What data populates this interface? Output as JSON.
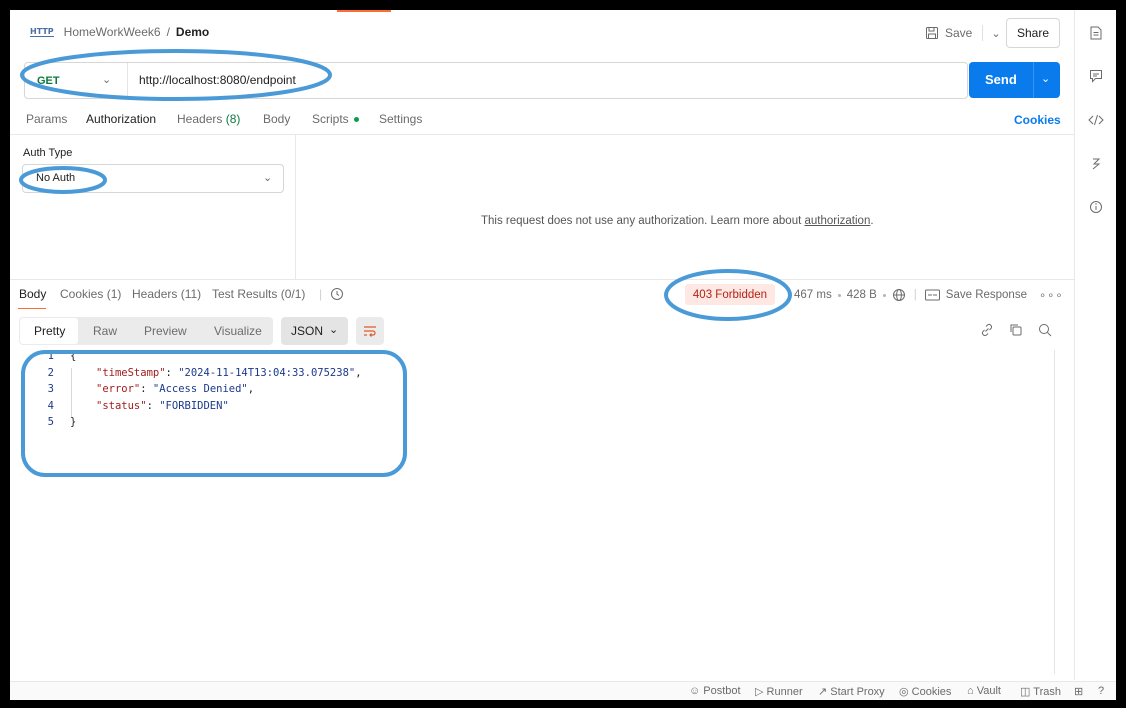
{
  "breadcrumb": {
    "icon": "http-icon",
    "parent": "HomeWorkWeek6",
    "separator": "/",
    "current": "Demo"
  },
  "header": {
    "save_label": "Save",
    "share_label": "Share"
  },
  "request": {
    "method": "GET",
    "url": "http://localhost:8080/endpoint",
    "send_label": "Send"
  },
  "request_tabs": [
    {
      "label": "Params"
    },
    {
      "label": "Authorization"
    },
    {
      "label": "Headers",
      "count": "(8)"
    },
    {
      "label": "Body"
    },
    {
      "label": "Scripts"
    },
    {
      "label": "Settings"
    }
  ],
  "cookies_link": "Cookies",
  "auth": {
    "type_label": "Auth Type",
    "selected": "No Auth",
    "message_prefix": "This request does not use any authorization. Learn more about ",
    "message_link": "authorization",
    "message_suffix": "."
  },
  "response_tabs": [
    {
      "label": "Body"
    },
    {
      "label": "Cookies",
      "count": "(1)"
    },
    {
      "label": "Headers",
      "count": "(11)"
    },
    {
      "label": "Test Results",
      "count": "(0/1)"
    }
  ],
  "response": {
    "status": "403 Forbidden",
    "time": "467 ms",
    "size": "428 B",
    "save_response": "Save Response",
    "status_color": "#b42318"
  },
  "format_tabs": [
    "Pretty",
    "Raw",
    "Preview",
    "Visualize"
  ],
  "format_select": "JSON",
  "code_lines": [
    {
      "n": "1",
      "text": "{"
    },
    {
      "n": "2",
      "key": "\"timeStamp\"",
      "value": "\"2024-11-14T13:04:33.075238\"",
      "trail": ","
    },
    {
      "n": "3",
      "key": "\"error\"",
      "value": "\"Access Denied\"",
      "trail": ","
    },
    {
      "n": "4",
      "key": "\"status\"",
      "value": "\"FORBIDDEN\"",
      "trail": ""
    },
    {
      "n": "5",
      "text": "}"
    }
  ],
  "footer": [
    "Postbot",
    "Runner",
    "Start Proxy",
    "Cookies",
    "Vault",
    "Trash"
  ],
  "colors": {
    "accent": "#ff6c37",
    "send": "#097bed",
    "annotation": "#4a9ad8",
    "method": "#0b7a3e"
  }
}
